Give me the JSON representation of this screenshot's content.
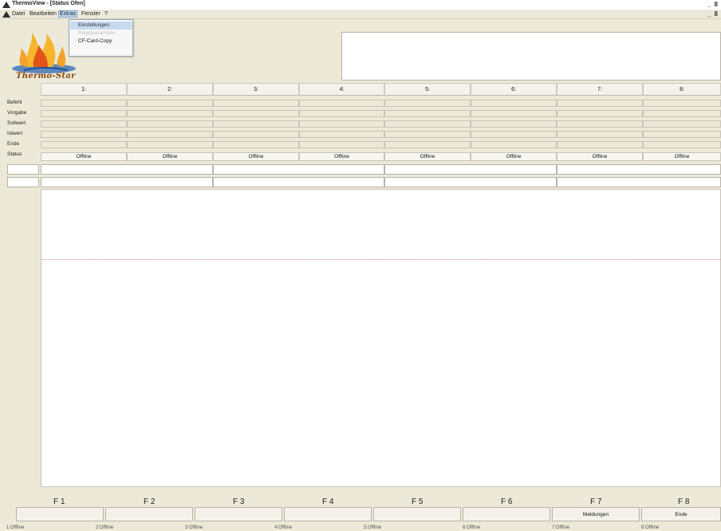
{
  "window": {
    "title": "ThermoView - [Status Ofen]",
    "title_ctl": "_ 8",
    "menu_ctl": "_ 8"
  },
  "menubar": {
    "items": [
      "Datei",
      "Bearbeiten",
      "Extras",
      "Fenster",
      "?"
    ]
  },
  "extras_menu": {
    "items": [
      {
        "label": "Einstellungen",
        "state": "highlighted"
      },
      {
        "label": "Regelparameter",
        "state": "disabled"
      },
      {
        "label": "CF-Card-Copy",
        "state": "normal"
      }
    ]
  },
  "logo": {
    "text": "Thermo-Star",
    "icon": "flame-logo-icon"
  },
  "columns": [
    "1:",
    "2:",
    "3:",
    "4:",
    "5:",
    "6:",
    "7:",
    "8:"
  ],
  "rows": [
    "Befehl",
    "Vorgabe",
    "Sollwert",
    "Istwert",
    "Ende",
    "Status"
  ],
  "status_values": [
    "Offline",
    "Offline",
    "Offline",
    "Offline",
    "Offline",
    "Offline",
    "Offline",
    "Offline"
  ],
  "fkeys": [
    {
      "key": "F 1",
      "label": ""
    },
    {
      "key": "F 2",
      "label": ""
    },
    {
      "key": "F 3",
      "label": ""
    },
    {
      "key": "F 4",
      "label": ""
    },
    {
      "key": "F 5",
      "label": ""
    },
    {
      "key": "F 6",
      "label": ""
    },
    {
      "key": "F 7",
      "label": "Meldungen"
    },
    {
      "key": "F 8",
      "label": "Ende"
    }
  ],
  "statusbar": [
    "1:Offline",
    "2:Offline",
    "3:Offline",
    "4:Offline",
    "5:Offline",
    "6:Offline",
    "7:Offline",
    "8:Offline"
  ],
  "colors": {
    "background": "#ece9d8",
    "highlight": "#c6daf0",
    "logo_text": "#8a4a12"
  }
}
